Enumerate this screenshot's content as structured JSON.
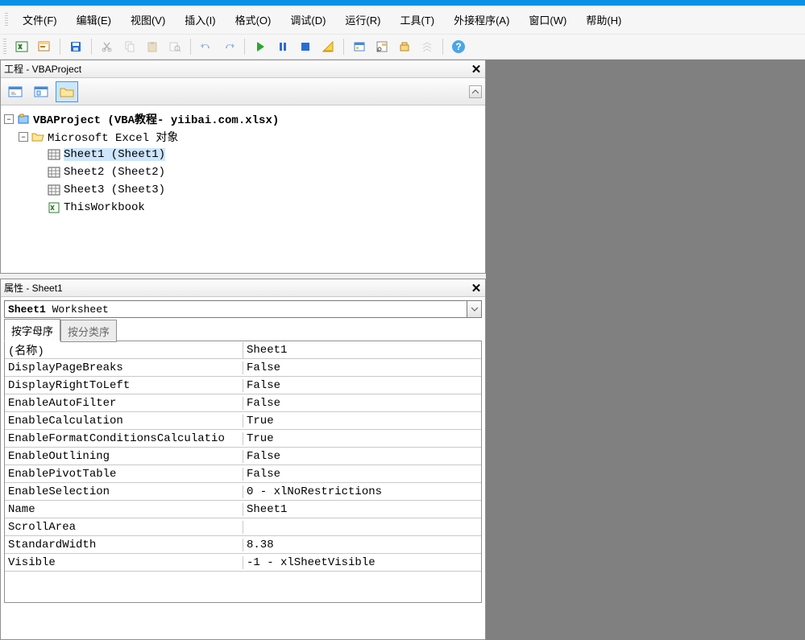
{
  "menubar": {
    "items": [
      {
        "label": "文件(F)"
      },
      {
        "label": "编辑(E)"
      },
      {
        "label": "视图(V)"
      },
      {
        "label": "插入(I)"
      },
      {
        "label": "格式(O)"
      },
      {
        "label": "调试(D)"
      },
      {
        "label": "运行(R)"
      },
      {
        "label": "工具(T)"
      },
      {
        "label": "外接程序(A)"
      },
      {
        "label": "窗口(W)"
      },
      {
        "label": "帮助(H)"
      }
    ]
  },
  "project_panel": {
    "title": "工程 - VBAProject",
    "tree": {
      "root": "VBAProject (VBA教程-  yiibai.com.xlsx)",
      "group": "Microsoft Excel 对象",
      "items": [
        {
          "label": "Sheet1 (Sheet1)",
          "selected": true
        },
        {
          "label": "Sheet2 (Sheet2)"
        },
        {
          "label": "Sheet3 (Sheet3)"
        }
      ],
      "workbook": "ThisWorkbook"
    }
  },
  "properties_panel": {
    "title": "属性 - Sheet1",
    "dropdown_bold": "Sheet1",
    "dropdown_rest": " Worksheet",
    "tabs": {
      "alpha": "按字母序",
      "category": "按分类序"
    },
    "rows": [
      {
        "k": "(名称)",
        "v": "Sheet1"
      },
      {
        "k": "DisplayPageBreaks",
        "v": "False"
      },
      {
        "k": "DisplayRightToLeft",
        "v": "False"
      },
      {
        "k": "EnableAutoFilter",
        "v": "False"
      },
      {
        "k": "EnableCalculation",
        "v": "True"
      },
      {
        "k": "EnableFormatConditionsCalculatio",
        "v": "True"
      },
      {
        "k": "EnableOutlining",
        "v": "False"
      },
      {
        "k": "EnablePivotTable",
        "v": "False"
      },
      {
        "k": "EnableSelection",
        "v": "0 - xlNoRestrictions"
      },
      {
        "k": "Name",
        "v": "Sheet1"
      },
      {
        "k": "ScrollArea",
        "v": ""
      },
      {
        "k": "StandardWidth",
        "v": "8.38"
      },
      {
        "k": "Visible",
        "v": "-1 - xlSheetVisible"
      }
    ]
  }
}
